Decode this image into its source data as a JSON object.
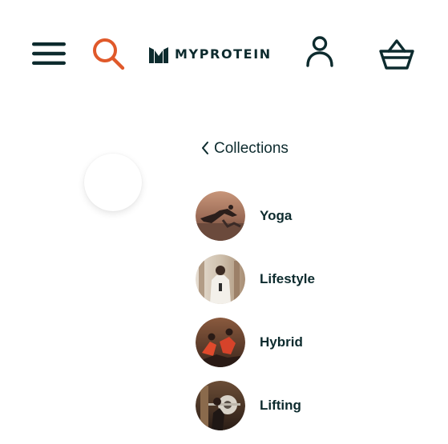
{
  "header": {
    "brand": "MYPROTEIN",
    "icons": {
      "menu": "hamburger-menu-icon",
      "search": "search-icon",
      "account": "user-account-icon",
      "basket": "shopping-basket-icon"
    },
    "colors": {
      "primary": "#0d2b2e",
      "search_accent": "#e0592a"
    }
  },
  "navigation": {
    "back_label": "Collections",
    "back_icon": "chevron-left-icon"
  },
  "collections": [
    {
      "label": "Yoga"
    },
    {
      "label": "Lifestyle"
    },
    {
      "label": "Hybrid"
    },
    {
      "label": "Lifting"
    }
  ]
}
